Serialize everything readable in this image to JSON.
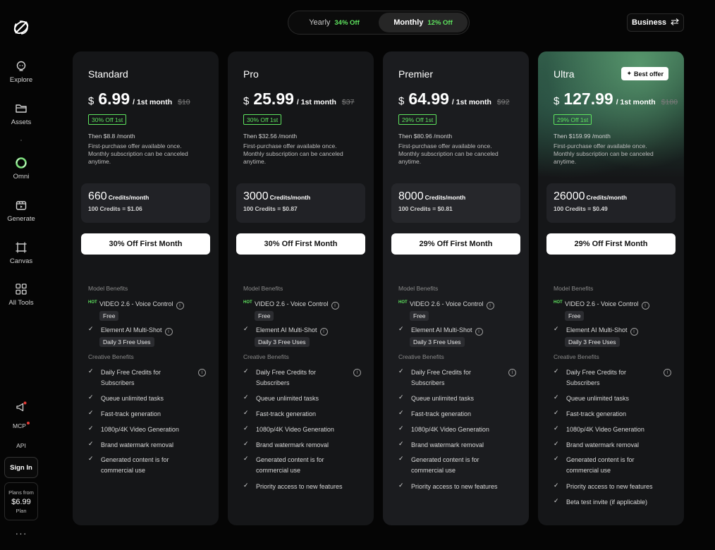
{
  "billing": {
    "yearly_label": "Yearly",
    "yearly_discount": "34% Off",
    "monthly_label": "Monthly",
    "monthly_discount": "12% Off",
    "selected": "Monthly"
  },
  "business_label": "Business",
  "sidebar": {
    "items": [
      {
        "label": "Explore",
        "icon": "lightbulb-icon"
      },
      {
        "label": "Assets",
        "icon": "folder-icon"
      },
      {
        "label": "Omni",
        "icon": "omni-ring-icon"
      },
      {
        "label": "Generate",
        "icon": "generate-icon"
      },
      {
        "label": "Canvas",
        "icon": "canvas-icon"
      },
      {
        "label": "All Tools",
        "icon": "grid-icon"
      }
    ],
    "announcement_icon": "megaphone-icon",
    "mcp_label": "MCP",
    "api_label": "API",
    "signin_label": "Sign In",
    "plans_from_label": "Plans from",
    "plans_from_price": "$6.99",
    "plans_from_suffix": "Plan",
    "more_label": "···"
  },
  "section_labels": {
    "model_benefits": "Model Benefits",
    "creative_benefits": "Creative Benefits"
  },
  "common_features": {
    "hot_label": "HOT",
    "video_feature": "VIDEO 2.6 - Voice Control",
    "free_tag": "Free",
    "element_feature": "Element AI Multi-Shot",
    "daily_tag": "Daily 3 Free Uses",
    "daily_credits": "Daily Free Credits for Subscribers",
    "queue": "Queue unlimited tasks",
    "fasttrack": "Fast-track generation",
    "video_gen": "1080p/4K Video Generation",
    "watermark": "Brand watermark removal",
    "commercial": "Generated content is for commercial use",
    "priority": "Priority access to new features",
    "beta": "Beta test invite (if applicable)"
  },
  "plans": [
    {
      "name": "Standard",
      "currency": "$",
      "price": "6.99",
      "per": "/ 1st month",
      "old_price": "$10",
      "discount": "30% Off 1st",
      "then": "Then $8.8 /month",
      "note": "First-purchase offer available once. Monthly subscription can be canceled anytime.",
      "credits": "660",
      "credits_unit": "Credits/month",
      "credit_rate": "100 Credits = $1.06",
      "cta": "30% Off First Month"
    },
    {
      "name": "Pro",
      "currency": "$",
      "price": "25.99",
      "per": "/ 1st month",
      "old_price": "$37",
      "discount": "30% Off 1st",
      "then": "Then $32.56 /month",
      "note": "First-purchase offer available once. Monthly subscription can be canceled anytime.",
      "credits": "3000",
      "credits_unit": "Credits/month",
      "credit_rate": "100 Credits = $0.87",
      "cta": "30% Off First Month"
    },
    {
      "name": "Premier",
      "currency": "$",
      "price": "64.99",
      "per": "/ 1st month",
      "old_price": "$92",
      "discount": "29% Off 1st",
      "then": "Then $80.96 /month",
      "note": "First-purchase offer available once. Monthly subscription can be canceled anytime.",
      "credits": "8000",
      "credits_unit": "Credits/month",
      "credit_rate": "100 Credits = $0.81",
      "cta": "29% Off First Month"
    },
    {
      "name": "Ultra",
      "badge": "Best offer",
      "currency": "$",
      "price": "127.99",
      "per": "/ 1st month",
      "old_price": "$180",
      "discount": "29% Off 1st",
      "then": "Then $159.99 /month",
      "note": "First-purchase offer available once. Monthly subscription can be canceled anytime.",
      "credits": "26000",
      "credits_unit": "Credits/month",
      "credit_rate": "100 Credits = $0.49",
      "cta": "29% Off First Month"
    }
  ],
  "colors": {
    "accent_green": "#5ee35e",
    "background": "#050505",
    "card": "#151618",
    "notification_red": "#e53935"
  }
}
